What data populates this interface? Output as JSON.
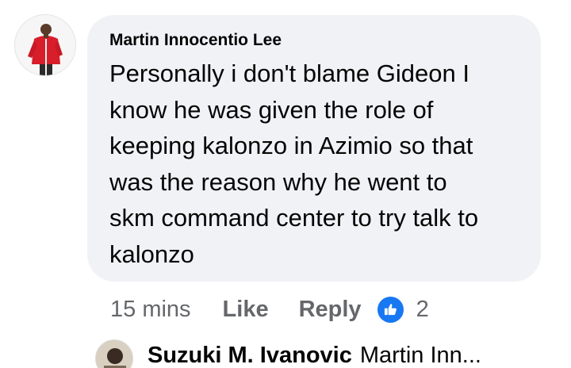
{
  "comment": {
    "author": "Martin Innocentio Lee",
    "text": "Personally i don't blame Gideon I\nknow he was given the role of\nkeeping kalonzo in Azimio so that\nwas the reason   why he went to\nskm command center to try talk to\nkalonzo",
    "avatar_icon": "profile-photo",
    "bubble_color": "#f0f2f5"
  },
  "actions": {
    "timestamp": "15 mins",
    "like_label": "Like",
    "reply_label": "Reply",
    "reaction_icon": "thumbs-up-icon",
    "reaction_color": "#1877f2",
    "reaction_count": "2"
  },
  "reply": {
    "author": "Suzuki M. Ivanovic",
    "snippet": "Martin Inn...",
    "avatar_icon": "profile-photo"
  }
}
